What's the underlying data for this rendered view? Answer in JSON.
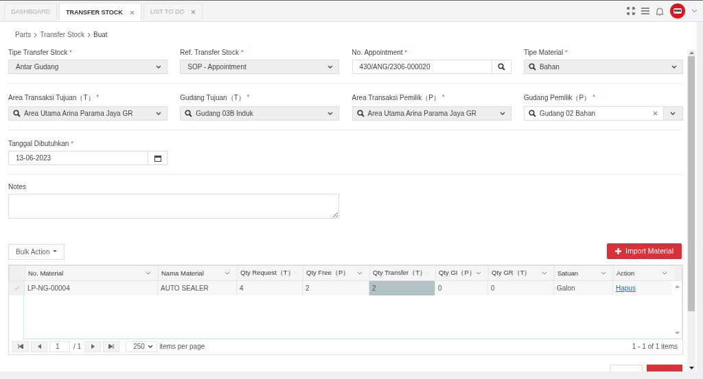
{
  "tabs": [
    {
      "label": "DASHBOARD",
      "selected": false,
      "closable": false
    },
    {
      "label": "TRANSFER STOCK",
      "selected": true,
      "closable": true
    },
    {
      "label": "LIST TO DO",
      "selected": false,
      "closable": true
    }
  ],
  "breadcrumb": [
    "Parts",
    "Transfer Stock",
    "Buat"
  ],
  "form_rows": [
    {
      "fields": [
        {
          "label": "Tipe Transfer Stock",
          "required_mark": "*",
          "kind": "select",
          "value": "Antar Gudang",
          "readonly": true
        },
        {
          "label": "Ref. Transfer Stock",
          "required_mark": "*",
          "kind": "select",
          "value": "SOP - Appointment",
          "readonly": true
        },
        {
          "label": "No. Appointment",
          "required_mark": "*",
          "kind": "lookup",
          "value": "430/ANG/2306-000020",
          "readonly": false
        },
        {
          "label": "Tipe Material",
          "required_mark": "*",
          "kind": "search-select",
          "value": "Bahan",
          "readonly": true
        }
      ]
    },
    {
      "fields": [
        {
          "label": "Area Transaksi Tujuan（T）",
          "required_mark": "*",
          "kind": "search-select",
          "value": "Area Utama Arina Parama Jaya GR",
          "readonly": true
        },
        {
          "label": "Gudang Tujuan（T）",
          "required_mark": "*",
          "kind": "search-select",
          "value": "Gudang 03B Induk",
          "readonly": true
        },
        {
          "label": "Area Transaksi Pemilik（P）",
          "required_mark": "*",
          "kind": "search-select",
          "value": "Area Utama Arina Parama Jaya GR",
          "readonly": true
        },
        {
          "label": "Gudang Pemilik（P）",
          "required_mark": "*",
          "kind": "clearable",
          "value": "Gudang 02 Bahan",
          "readonly": false
        }
      ]
    },
    {
      "fields": [
        {
          "label": "Tanggal Dibutuhkan",
          "required_mark": "*",
          "kind": "date",
          "value": "13-06-2023",
          "readonly": false
        }
      ]
    }
  ],
  "notes": {
    "label": "Notes"
  },
  "bulk_action": "Bulk Action",
  "import_button": "Import Material",
  "grid": {
    "columns": [
      "No. Material",
      "Nama Material",
      "Qty Request（T）",
      "Qty Free（P）",
      "Qty Transfer（T）",
      "Qty GI（P）",
      "Qty GR（T）",
      "Satuan",
      "Action"
    ],
    "rows": [
      {
        "checked": false,
        "cells": [
          {
            "kind": "text",
            "text": "LP-NG-00004",
            "selected": false
          },
          {
            "kind": "text",
            "text": "AUTO SEALER",
            "selected": false
          },
          {
            "kind": "text",
            "text": "4",
            "selected": false
          },
          {
            "kind": "text",
            "text": "2",
            "selected": false
          },
          {
            "kind": "text",
            "text": "2",
            "selected": true
          },
          {
            "kind": "text",
            "text": "0",
            "selected": false
          },
          {
            "kind": "text",
            "text": "0",
            "selected": false
          },
          {
            "kind": "text",
            "text": "Galon",
            "selected": false
          },
          {
            "kind": "link",
            "text": "Hapus",
            "selected": false
          }
        ]
      }
    ],
    "pager": {
      "page": "1",
      "of": "/ 1",
      "page_size": "250",
      "per_page_label": "items per page",
      "summary": "1 - 1 of 1 items"
    }
  }
}
